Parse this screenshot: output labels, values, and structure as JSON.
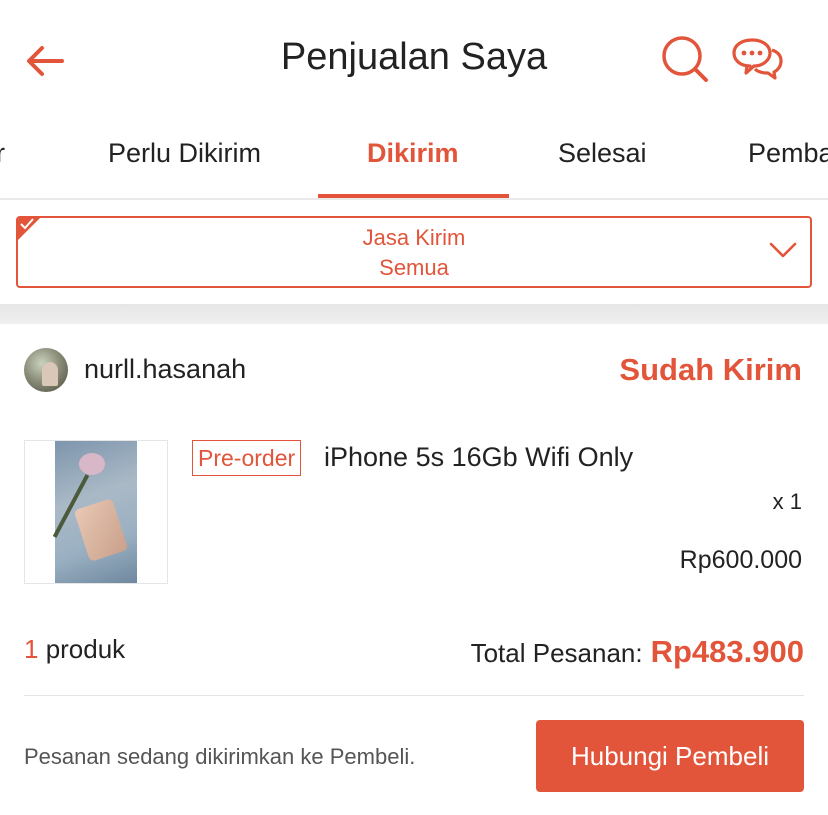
{
  "header": {
    "title": "Penjualan Saya",
    "icons": {
      "back": "arrow-left-icon",
      "search": "search-icon",
      "chat": "chat-bubbles-icon"
    }
  },
  "tabs": [
    {
      "label": "r"
    },
    {
      "label": "Perlu Dikirim"
    },
    {
      "label": "Dikirim",
      "active": true
    },
    {
      "label": "Selesai"
    },
    {
      "label": "Pembatalan"
    }
  ],
  "filter": {
    "label": "Jasa Kirim",
    "value": "Semua"
  },
  "order": {
    "buyer": "nurll.hasanah",
    "status": "Sudah Kirim",
    "product": {
      "tag": "Pre-order",
      "name": "iPhone 5s 16Gb Wifi Only",
      "qty": "x 1",
      "price": "Rp600.000"
    },
    "summary": {
      "count": "1",
      "count_label": "produk",
      "total_label": "Total Pesanan:",
      "total_value": "Rp483.900"
    },
    "note": "Pesanan sedang dikirimkan ke Pembeli.",
    "action_label": "Hubungi Pembeli"
  },
  "colors": {
    "accent": "#e2553a",
    "text": "#222222",
    "muted": "#555555"
  }
}
